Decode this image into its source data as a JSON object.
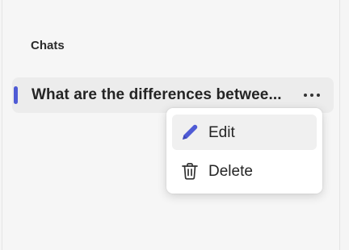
{
  "sidebar": {
    "section_title": "Chats",
    "chats": [
      {
        "title": "What are the differences betwee..."
      }
    ]
  },
  "context_menu": {
    "items": [
      {
        "label": "Edit",
        "icon": "pencil-icon"
      },
      {
        "label": "Delete",
        "icon": "trash-icon"
      }
    ]
  },
  "colors": {
    "accent": "#4f5bd5",
    "selected_bg": "#ececec",
    "menu_hover_bg": "#f0f0f0"
  }
}
